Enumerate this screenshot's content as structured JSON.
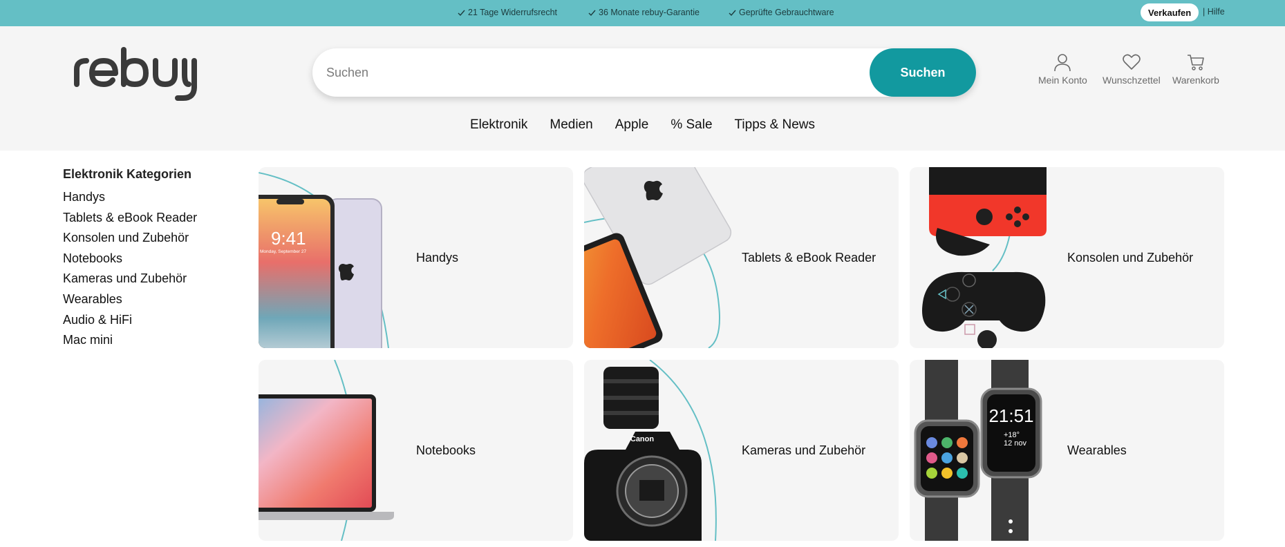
{
  "topbar": {
    "usps": [
      "21 Tage Widerrufsrecht",
      "36 Monate rebuy-Garantie",
      "Geprüfte Gebrauchtware"
    ],
    "sell_label": "Verkaufen",
    "help_label": "| Hilfe"
  },
  "header": {
    "logo_alt": "rebuy",
    "search": {
      "placeholder": "Suchen",
      "value": "",
      "button_label": "Suchen"
    },
    "icons": [
      {
        "icon": "user-icon",
        "label": "Mein Konto"
      },
      {
        "icon": "heart-icon",
        "label": "Wunschzettel"
      },
      {
        "icon": "cart-icon",
        "label": "Warenkorb"
      }
    ],
    "nav": [
      "Elektronik",
      "Medien",
      "Apple",
      "% Sale",
      "Tipps & News"
    ]
  },
  "sidebar": {
    "title": "Elektronik Kategorien",
    "items": [
      "Handys",
      "Tablets & eBook Reader",
      "Konsolen und Zubehör",
      "Notebooks",
      "Kameras und Zubehör",
      "Wearables",
      "Audio & HiFi",
      "Mac mini"
    ]
  },
  "tiles": [
    {
      "label": "Handys",
      "image": "smartphone-image"
    },
    {
      "label": "Tablets & eBook Reader",
      "image": "tablet-image"
    },
    {
      "label": "Konsolen und Zubehör",
      "image": "console-controller-image"
    },
    {
      "label": "Notebooks",
      "image": "laptop-image"
    },
    {
      "label": "Kameras und Zubehör",
      "image": "camera-image"
    },
    {
      "label": "Wearables",
      "image": "smartwatch-image"
    }
  ],
  "phone_screen": {
    "time": "9:41",
    "date": "Monday, September 27"
  },
  "watch_screen": {
    "time": "21:51",
    "temp": "+18°",
    "date": "12 nov"
  },
  "camera_brand": "Canon",
  "colors": {
    "topbar": "#64bfc5",
    "accent": "#12999f",
    "header_bg": "#f5f5f5",
    "tile_bg": "#f5f5f5"
  }
}
